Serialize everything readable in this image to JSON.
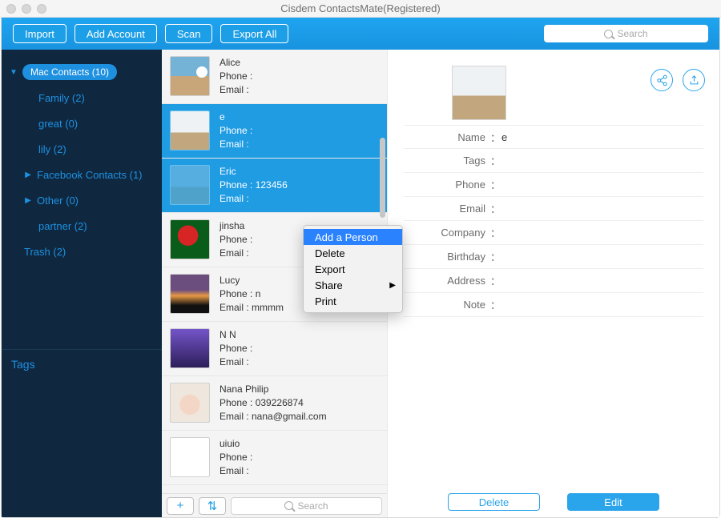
{
  "window_title": "Cisdem ContactsMate(Registered)",
  "toolbar": {
    "import": "Import",
    "add_account": "Add Account",
    "scan": "Scan",
    "export_all": "Export All",
    "search_placeholder": "Search"
  },
  "sidebar": {
    "main_group": "Mac Contacts (10)",
    "items": [
      {
        "label": "Family (2)",
        "kind": "child"
      },
      {
        "label": "great (0)",
        "kind": "child"
      },
      {
        "label": "lily (2)",
        "kind": "child"
      },
      {
        "label": "Facebook Contacts (1)",
        "kind": "expand"
      },
      {
        "label": "Other (0)",
        "kind": "expand"
      },
      {
        "label": "partner (2)",
        "kind": "child"
      },
      {
        "label": "Trash (2)",
        "kind": "trash"
      }
    ],
    "tags_header": "Tags"
  },
  "contacts": [
    {
      "name": "Alice",
      "phone": "Phone :",
      "email": "Email :",
      "selected": false,
      "avatar": "av-beach"
    },
    {
      "name": "e",
      "phone": "Phone :",
      "email": "Email :",
      "selected": true,
      "avatar": "av-girl"
    },
    {
      "name": "Eric",
      "phone": "Phone : 123456",
      "email": "Email :",
      "selected": true,
      "avatar": "av-cloud"
    },
    {
      "name": "jinsha",
      "phone": "Phone :",
      "email": "Email :",
      "selected": false,
      "avatar": "av-parrot"
    },
    {
      "name": "Lucy",
      "phone": "Phone : n",
      "email": "Email : mmmm",
      "selected": false,
      "avatar": "av-sunset"
    },
    {
      "name": "N N",
      "phone": "Phone :",
      "email": "Email :",
      "selected": false,
      "avatar": "av-run"
    },
    {
      "name": "Nana Philip",
      "phone": "Phone : 039226874",
      "email": "Email : nana@gmail.com",
      "selected": false,
      "avatar": "av-baby"
    },
    {
      "name": "uiuio",
      "phone": "Phone :",
      "email": "Email :",
      "selected": false,
      "avatar": "av-anime"
    }
  ],
  "mid_bottom": {
    "add": "+",
    "sort": "⇅",
    "search_placeholder": "Search"
  },
  "context_menu": {
    "items": [
      "Add a Person",
      "Delete",
      "Export",
      "Share",
      "Print"
    ],
    "highlighted": 0,
    "submenu_index": 3
  },
  "detail": {
    "name_value": "e",
    "fields": [
      {
        "label": "Name",
        "value": "e"
      },
      {
        "label": "Tags",
        "value": ""
      },
      {
        "label": "Phone",
        "value": ""
      },
      {
        "label": "Email",
        "value": ""
      },
      {
        "label": "Company",
        "value": ""
      },
      {
        "label": "Birthday",
        "value": ""
      },
      {
        "label": "Address",
        "value": ""
      },
      {
        "label": "Note",
        "value": ""
      }
    ],
    "delete": "Delete",
    "edit": "Edit"
  }
}
